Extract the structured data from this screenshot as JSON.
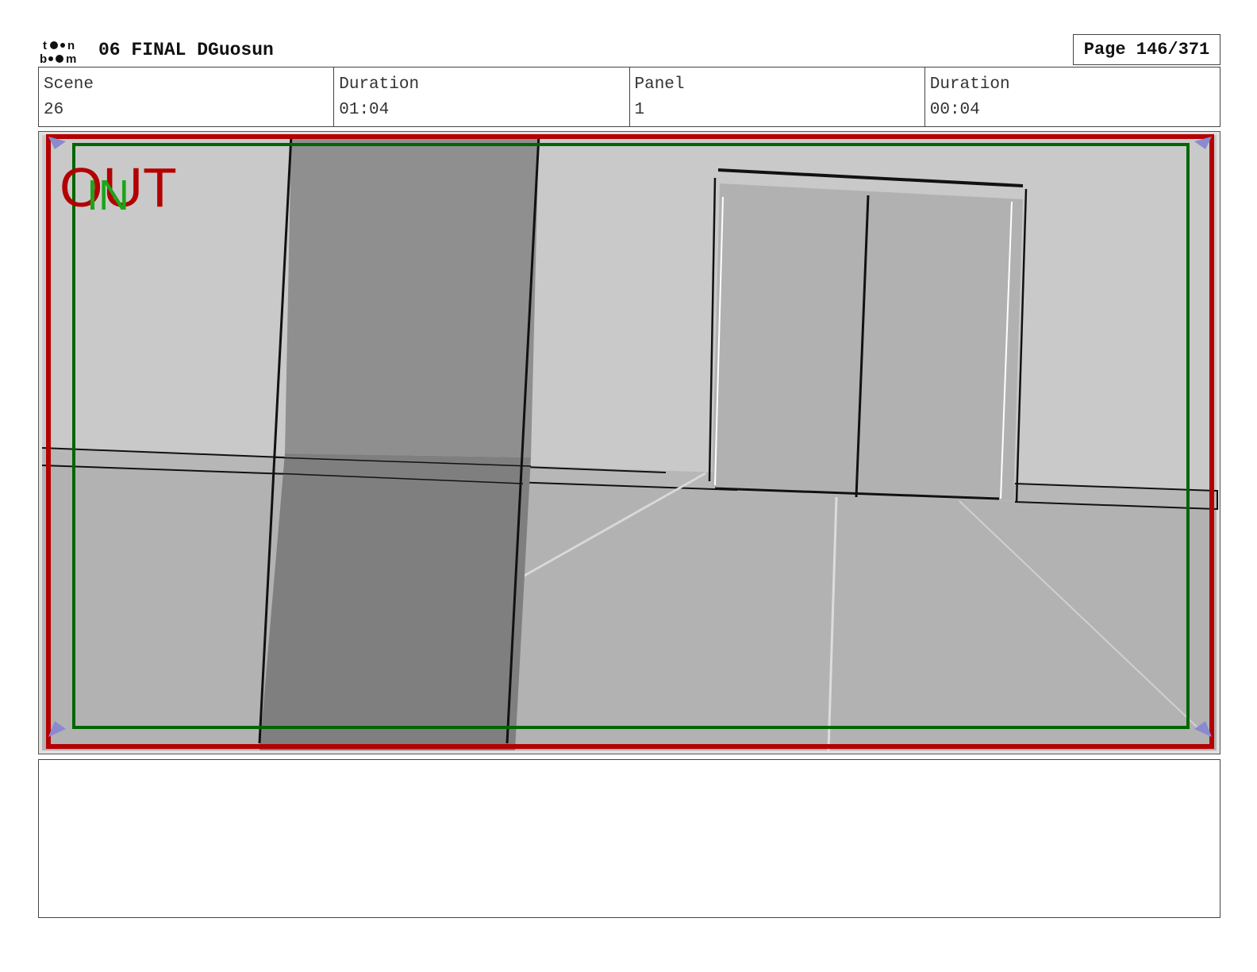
{
  "header": {
    "logo_text": "toon boom",
    "project_title": "06 FINAL DGuosun",
    "page_label": "Page 146/371"
  },
  "info": {
    "scene_label": "Scene",
    "scene_value": "26",
    "scene_duration_label": "Duration",
    "scene_duration_value": "01:04",
    "panel_label": "Panel",
    "panel_value": "1",
    "panel_duration_label": "Duration",
    "panel_duration_value": "00:04"
  },
  "panel": {
    "frame_out_label": "OUT",
    "frame_in_label": "IN",
    "colors": {
      "frame_out": "#b40000",
      "frame_in": "#006600",
      "wall": "#c9c9c9",
      "floor": "#b2b2b2",
      "pillar": "#8f8f8f",
      "pillar_lower": "#7f7f7f",
      "door": "#b1b1b1"
    }
  },
  "notes": {
    "text": ""
  }
}
